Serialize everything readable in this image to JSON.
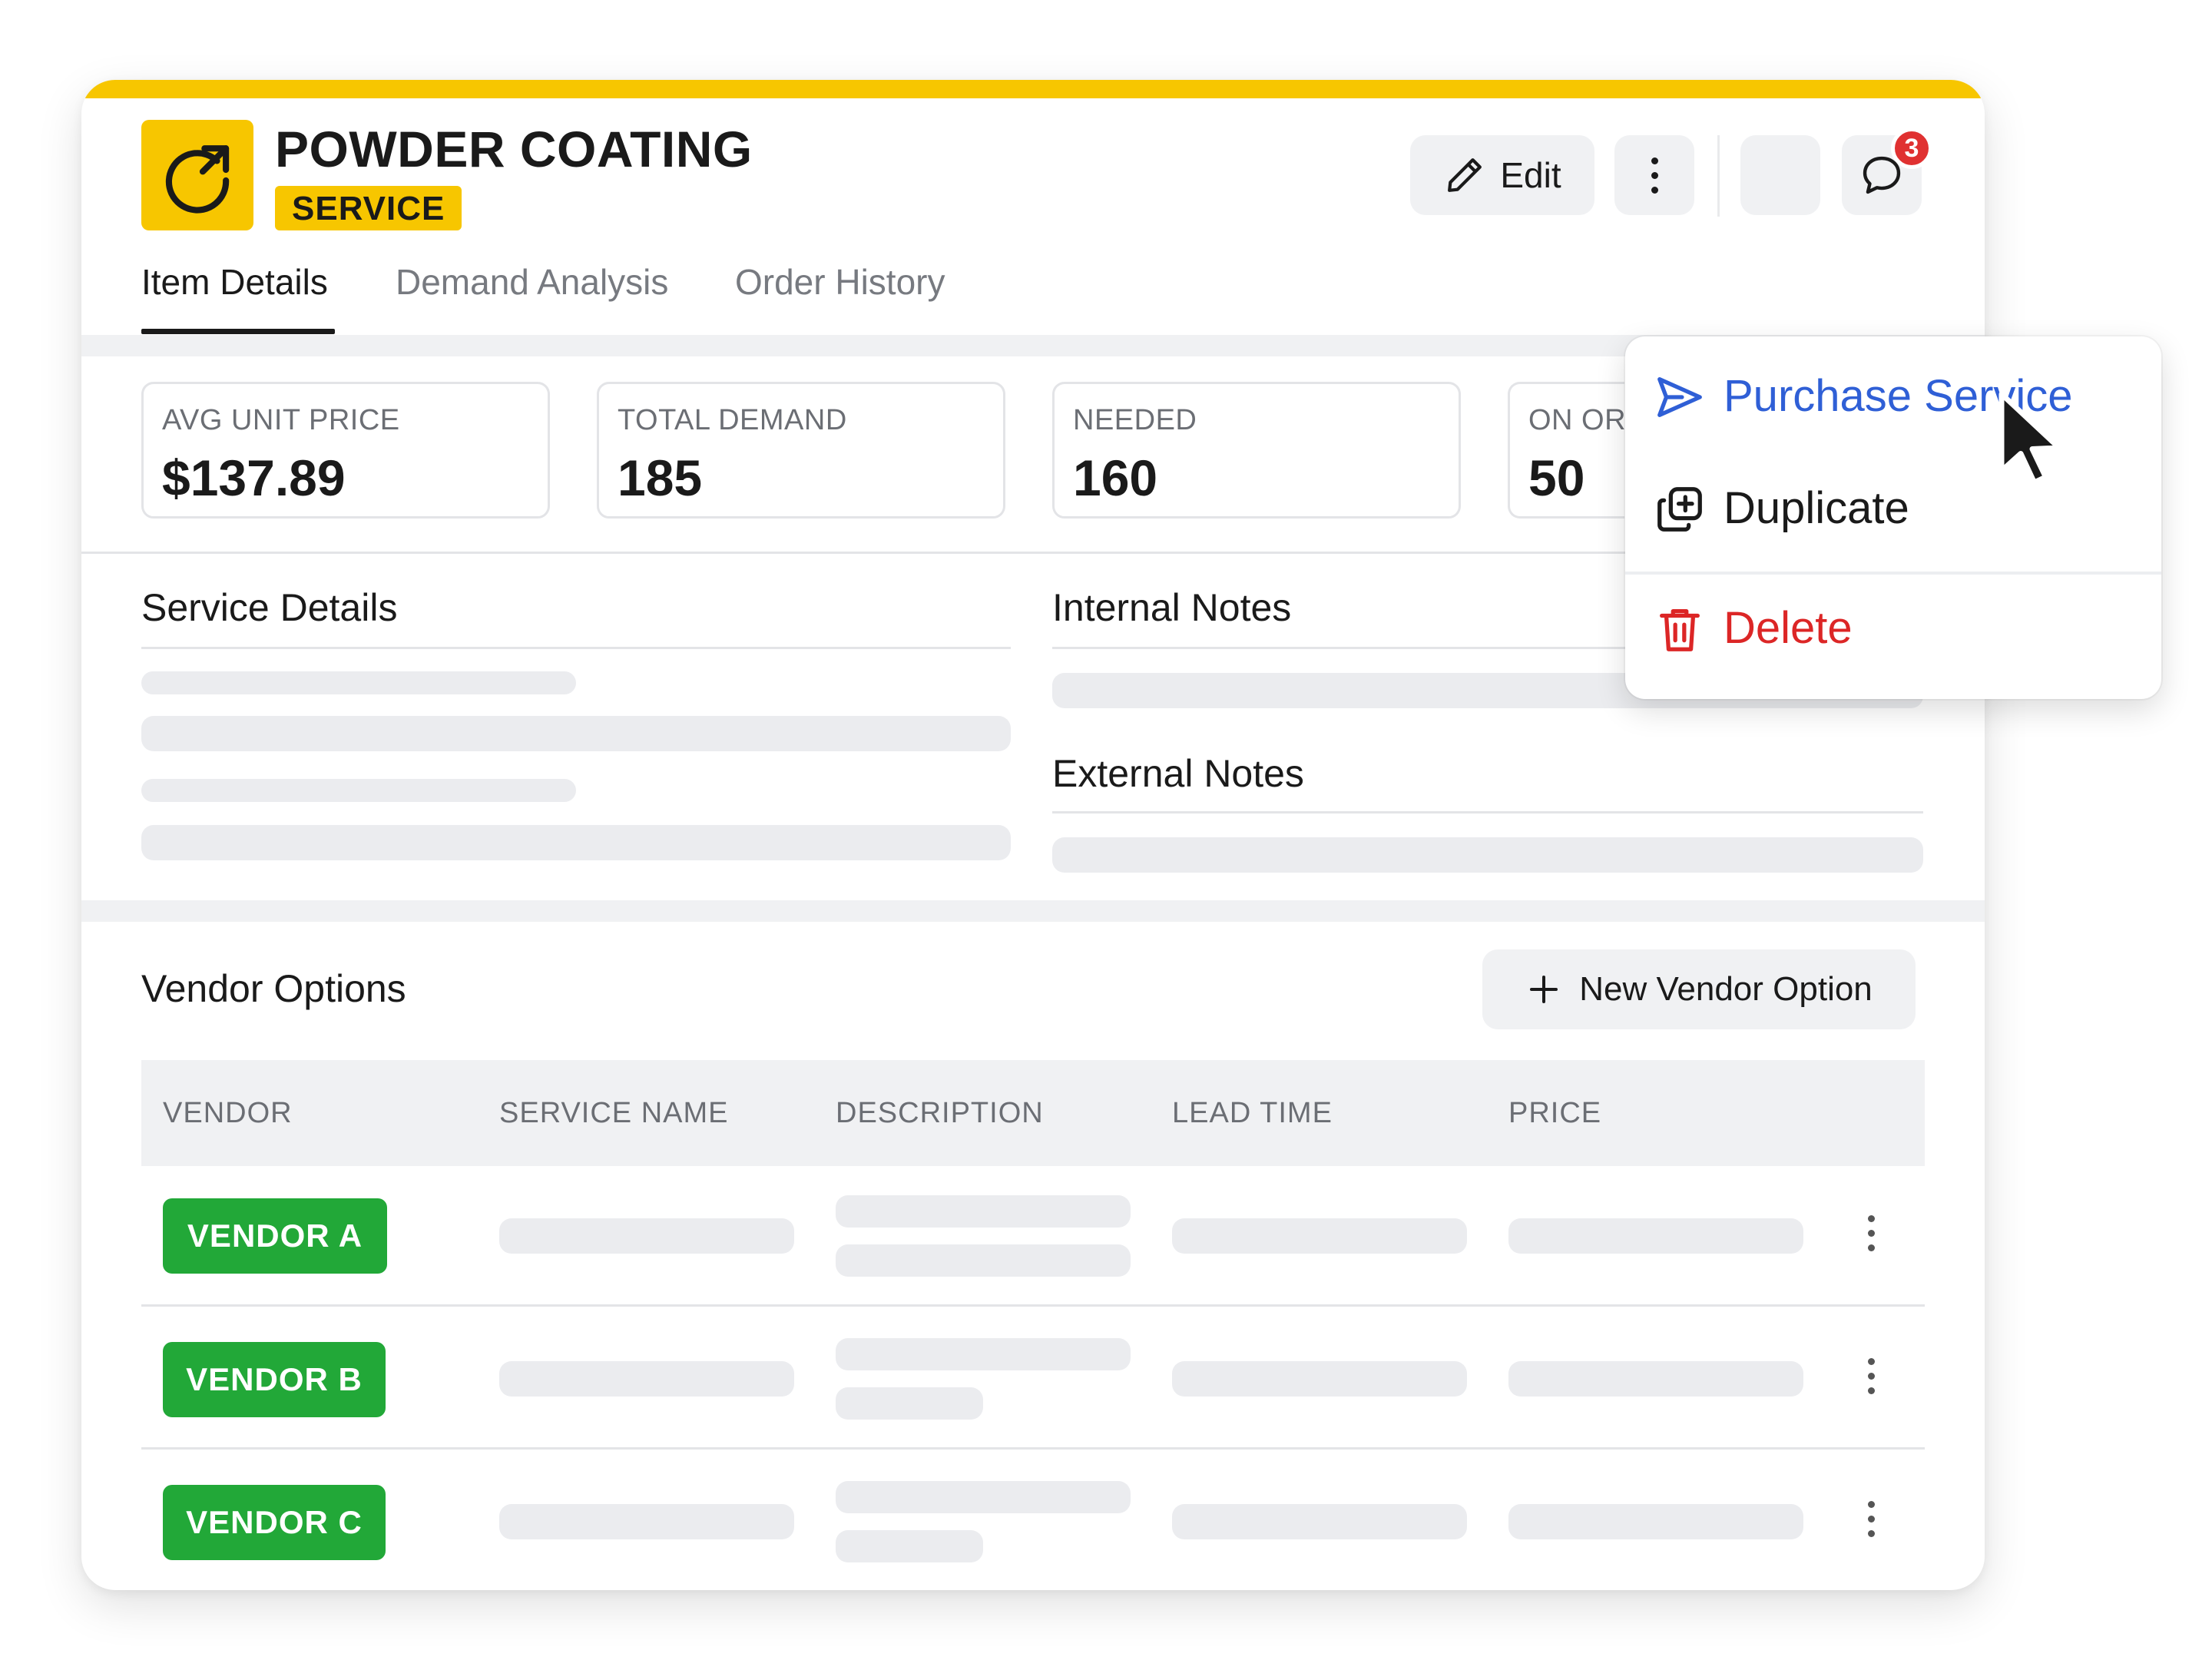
{
  "header": {
    "item_icon": "rotate-arrow-icon",
    "title": "POWDER COATING",
    "type_badge": "SERVICE",
    "edit_label": "Edit",
    "more_icon": "more-vertical-icon",
    "chat_icon": "chat-bubble-icon",
    "notification_count": "3"
  },
  "tabs": [
    {
      "label": "Item Details",
      "active": true
    },
    {
      "label": "Demand Analysis",
      "active": false
    },
    {
      "label": "Order History",
      "active": false
    }
  ],
  "stats": [
    {
      "label": "AVG UNIT PRICE",
      "value": "$137.89"
    },
    {
      "label": "TOTAL DEMAND",
      "value": "185"
    },
    {
      "label": "NEEDED",
      "value": "160"
    },
    {
      "label": "ON ORI",
      "value": "50"
    }
  ],
  "sections": {
    "service_details": "Service Details",
    "internal_notes": "Internal Notes",
    "external_notes": "External Notes"
  },
  "vendors": {
    "title": "Vendor Options",
    "new_button": "New Vendor Option",
    "columns": [
      "VENDOR",
      "SERVICE NAME",
      "DESCRIPTION",
      "LEAD TIME",
      "PRICE"
    ],
    "rows": [
      {
        "vendor": "VENDOR A"
      },
      {
        "vendor": "VENDOR B"
      },
      {
        "vendor": "VENDOR C"
      }
    ]
  },
  "menu": {
    "items": [
      {
        "label": "Purchase Service",
        "icon": "send-icon",
        "color": "#2f5fd6"
      },
      {
        "label": "Duplicate",
        "icon": "duplicate-icon",
        "color": "#1a1a1a"
      },
      {
        "label": "Delete",
        "icon": "trash-icon",
        "color": "#dc2626"
      }
    ]
  },
  "colors": {
    "accent_yellow": "#f7c600",
    "vendor_green": "#22a838",
    "primary_blue": "#2f5fd6",
    "danger_red": "#dc2626",
    "badge_red": "#e03131"
  }
}
